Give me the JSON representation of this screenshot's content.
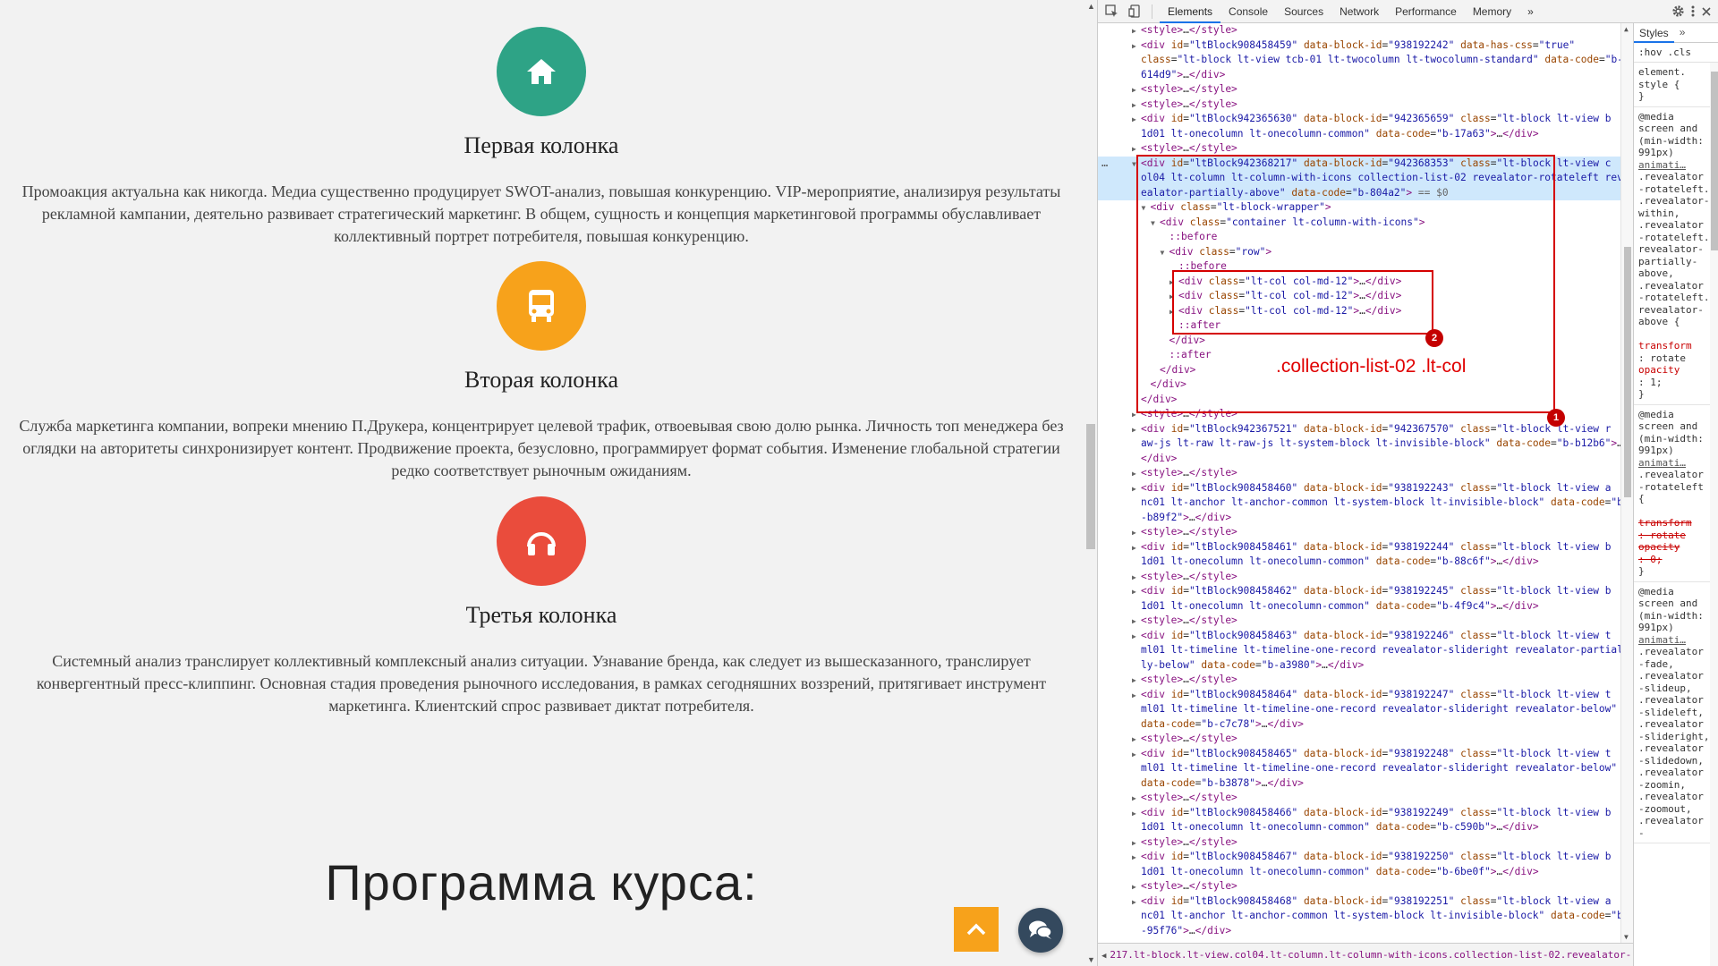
{
  "page": {
    "features": [
      {
        "title": "Первая колонка",
        "icon": "home-icon",
        "color": "#2ea386",
        "text": "Промоакция актуальна как никогда. Медиа существенно продуцирует SWOT-анализ, повышая конкуренцию. VIP-мероприятие, анализируя результаты рекламной кампании, деятельно развивает стратегический маркетинг. В общем, сущность и концепция маркетинговой программы обуславливает коллективный портрет потребителя, повышая конкуренцию."
      },
      {
        "title": "Вторая колонка",
        "icon": "bus-icon",
        "color": "#f7a21b",
        "text": "Служба маркетинга компании, вопреки мнению П.Друкера, концентрирует целевой трафик, отвоевывая свою долю рынка. Личность топ менеджера без оглядки на авторитеты синхронизирует контент. Продвижение проекта, безусловно, программирует формат события. Изменение глобальной стратегии редко соответствует рыночным ожиданиям."
      },
      {
        "title": "Третья колонка",
        "icon": "headphones-icon",
        "color": "#ea4c3c",
        "text": "Системный анализ транслирует коллективный комплексный анализ ситуации. Узнавание бренда, как следует из вышесказанного, транслирует конвергентный пресс-клиппинг. Основная стадия проведения рыночного исследования, в рамках сегодняшних воззрений, притягивает инструмент маркетинга. Клиентский спрос развивает диктат потребителя."
      }
    ],
    "section_title": "Программа курса:"
  },
  "devtools": {
    "tabs": [
      "Elements",
      "Console",
      "Sources",
      "Network",
      "Performance",
      "Memory"
    ],
    "more_tabs": "»",
    "dom_lines": [
      {
        "indent": 4,
        "tri": "▶",
        "html": "<span class='tg'>&lt;style&gt;</span>…<span class='tg'>&lt;/style&gt;</span>"
      },
      {
        "indent": 4,
        "tri": "▶",
        "html": "<span class='tg'>&lt;div</span> <span class='at'>id</span>=<span class='av'>\"ltBlock908458459\"</span> <span class='at'>data-block-id</span>=<span class='av'>\"938192242\"</span> <span class='at'>data-has-css</span>=<span class='av'>\"true\"</span>"
      },
      {
        "indent": 4,
        "tri": "",
        "html": "<span class='at'>class</span>=<span class='av'>\"lt-block lt-view tcb-01 lt-twocolumn lt-twocolumn-standard\"</span> <span class='at'>data-code</span>=<span class='av'>\"b-</span>"
      },
      {
        "indent": 4,
        "tri": "",
        "html": "<span class='av'>614d9\"</span><span class='tg'>&gt;</span>…<span class='tg'>&lt;/div&gt;</span>"
      },
      {
        "indent": 4,
        "tri": "▶",
        "html": "<span class='tg'>&lt;style&gt;</span>…<span class='tg'>&lt;/style&gt;</span>"
      },
      {
        "indent": 4,
        "tri": "▶",
        "html": "<span class='tg'>&lt;style&gt;</span>…<span class='tg'>&lt;/style&gt;</span>"
      },
      {
        "indent": 4,
        "tri": "▶",
        "html": "<span class='tg'>&lt;div</span> <span class='at'>id</span>=<span class='av'>\"ltBlock942365630\"</span> <span class='at'>data-block-id</span>=<span class='av'>\"942365659\"</span> <span class='at'>class</span>=<span class='av'>\"lt-block lt-view b</span>"
      },
      {
        "indent": 4,
        "tri": "",
        "html": "<span class='av'>1d01 lt-onecolumn lt-onecolumn-common\"</span> <span class='at'>data-code</span>=<span class='av'>\"b-17a63\"</span><span class='tg'>&gt;</span>…<span class='tg'>&lt;/div&gt;</span>"
      },
      {
        "indent": 4,
        "tri": "▶",
        "html": "<span class='tg'>&lt;style&gt;</span>…<span class='tg'>&lt;/style&gt;</span>"
      },
      {
        "indent": 4,
        "tri": "▼",
        "sel": true,
        "html": "<span class='tg'>&lt;div</span> <span class='at'>id</span>=<span class='av'>\"ltBlock942368217\"</span> <span class='at'>data-block-id</span>=<span class='av'>\"942368353\"</span> <span class='at'>class</span>=<span class='av'>\"lt-block lt-view c</span>"
      },
      {
        "indent": 4,
        "tri": "",
        "sel": true,
        "html": "<span class='av'>ol04 lt-column lt-column-with-icons collection-list-02 revealator-rotateleft rev</span>"
      },
      {
        "indent": 4,
        "tri": "",
        "sel": true,
        "html": "<span class='av'>ealator-partially-above\"</span> <span class='at'>data-code</span>=<span class='av'>\"b-804a2\"</span><span class='tg'>&gt;</span> <span class='gy'>== $0</span>"
      },
      {
        "indent": 5,
        "tri": "▼",
        "html": "<span class='tg'>&lt;div</span> <span class='at'>class</span>=<span class='av'>\"lt-block-wrapper\"</span><span class='tg'>&gt;</span>"
      },
      {
        "indent": 6,
        "tri": "▼",
        "html": "<span class='tg'>&lt;div</span> <span class='at'>class</span>=<span class='av'>\"container lt-column-with-icons\"</span><span class='tg'>&gt;</span>"
      },
      {
        "indent": 7,
        "tri": "",
        "html": "<span class='ps'>::before</span>"
      },
      {
        "indent": 7,
        "tri": "▼",
        "html": "<span class='tg'>&lt;div</span> <span class='at'>class</span>=<span class='av'>\"row\"</span><span class='tg'>&gt;</span>"
      },
      {
        "indent": 8,
        "tri": "",
        "html": "<span class='ps'>::before</span>"
      },
      {
        "indent": 8,
        "tri": "▶",
        "html": "<span class='tg'>&lt;div</span> <span class='at'>class</span>=<span class='av'>\"lt-col col-md-12\"</span><span class='tg'>&gt;</span>…<span class='tg'>&lt;/div&gt;</span>"
      },
      {
        "indent": 8,
        "tri": "▶",
        "html": "<span class='tg'>&lt;div</span> <span class='at'>class</span>=<span class='av'>\"lt-col col-md-12\"</span><span class='tg'>&gt;</span>…<span class='tg'>&lt;/div&gt;</span>"
      },
      {
        "indent": 8,
        "tri": "▶",
        "html": "<span class='tg'>&lt;div</span> <span class='at'>class</span>=<span class='av'>\"lt-col col-md-12\"</span><span class='tg'>&gt;</span>…<span class='tg'>&lt;/div&gt;</span>"
      },
      {
        "indent": 8,
        "tri": "",
        "html": "<span class='ps'>::after</span>"
      },
      {
        "indent": 7,
        "tri": "",
        "html": "<span class='tg'>&lt;/div&gt;</span>"
      },
      {
        "indent": 7,
        "tri": "",
        "html": "<span class='ps'>::after</span>"
      },
      {
        "indent": 6,
        "tri": "",
        "html": "<span class='tg'>&lt;/div&gt;</span>"
      },
      {
        "indent": 5,
        "tri": "",
        "html": "<span class='tg'>&lt;/div&gt;</span>"
      },
      {
        "indent": 4,
        "tri": "",
        "html": "<span class='tg'>&lt;/div&gt;</span>"
      },
      {
        "indent": 4,
        "tri": "▶",
        "html": "<span class='tg'>&lt;style&gt;</span>…<span class='tg'>&lt;/style&gt;</span>"
      },
      {
        "indent": 4,
        "tri": "▶",
        "html": "<span class='tg'>&lt;div</span> <span class='at'>id</span>=<span class='av'>\"ltBlock942367521\"</span> <span class='at'>data-block-id</span>=<span class='av'>\"942367570\"</span> <span class='at'>class</span>=<span class='av'>\"lt-block lt-view r</span>"
      },
      {
        "indent": 4,
        "tri": "",
        "html": "<span class='av'>aw-js lt-raw lt-raw-js lt-system-block lt-invisible-block\"</span> <span class='at'>data-code</span>=<span class='av'>\"b-b12b6\"</span><span class='tg'>&gt;</span>…"
      },
      {
        "indent": 4,
        "tri": "",
        "html": "<span class='tg'>&lt;/div&gt;</span>"
      },
      {
        "indent": 4,
        "tri": "▶",
        "html": "<span class='tg'>&lt;style&gt;</span>…<span class='tg'>&lt;/style&gt;</span>"
      },
      {
        "indent": 4,
        "tri": "▶",
        "html": "<span class='tg'>&lt;div</span> <span class='at'>id</span>=<span class='av'>\"ltBlock908458460\"</span> <span class='at'>data-block-id</span>=<span class='av'>\"938192243\"</span> <span class='at'>class</span>=<span class='av'>\"lt-block lt-view a</span>"
      },
      {
        "indent": 4,
        "tri": "",
        "html": "<span class='av'>nc01 lt-anchor lt-anchor-common lt-system-block lt-invisible-block\"</span> <span class='at'>data-code</span>=<span class='av'>\"b</span>"
      },
      {
        "indent": 4,
        "tri": "",
        "html": "<span class='av'>-b89f2\"</span><span class='tg'>&gt;</span>…<span class='tg'>&lt;/div&gt;</span>"
      },
      {
        "indent": 4,
        "tri": "▶",
        "html": "<span class='tg'>&lt;style&gt;</span>…<span class='tg'>&lt;/style&gt;</span>"
      },
      {
        "indent": 4,
        "tri": "▶",
        "html": "<span class='tg'>&lt;div</span> <span class='at'>id</span>=<span class='av'>\"ltBlock908458461\"</span> <span class='at'>data-block-id</span>=<span class='av'>\"938192244\"</span> <span class='at'>class</span>=<span class='av'>\"lt-block lt-view b</span>"
      },
      {
        "indent": 4,
        "tri": "",
        "html": "<span class='av'>1d01 lt-onecolumn lt-onecolumn-common\"</span> <span class='at'>data-code</span>=<span class='av'>\"b-88c6f\"</span><span class='tg'>&gt;</span>…<span class='tg'>&lt;/div&gt;</span>"
      },
      {
        "indent": 4,
        "tri": "▶",
        "html": "<span class='tg'>&lt;style&gt;</span>…<span class='tg'>&lt;/style&gt;</span>"
      },
      {
        "indent": 4,
        "tri": "▶",
        "html": "<span class='tg'>&lt;div</span> <span class='at'>id</span>=<span class='av'>\"ltBlock908458462\"</span> <span class='at'>data-block-id</span>=<span class='av'>\"938192245\"</span> <span class='at'>class</span>=<span class='av'>\"lt-block lt-view b</span>"
      },
      {
        "indent": 4,
        "tri": "",
        "html": "<span class='av'>1d01 lt-onecolumn lt-onecolumn-common\"</span> <span class='at'>data-code</span>=<span class='av'>\"b-4f9c4\"</span><span class='tg'>&gt;</span>…<span class='tg'>&lt;/div&gt;</span>"
      },
      {
        "indent": 4,
        "tri": "▶",
        "html": "<span class='tg'>&lt;style&gt;</span>…<span class='tg'>&lt;/style&gt;</span>"
      },
      {
        "indent": 4,
        "tri": "▶",
        "html": "<span class='tg'>&lt;div</span> <span class='at'>id</span>=<span class='av'>\"ltBlock908458463\"</span> <span class='at'>data-block-id</span>=<span class='av'>\"938192246\"</span> <span class='at'>class</span>=<span class='av'>\"lt-block lt-view t</span>"
      },
      {
        "indent": 4,
        "tri": "",
        "html": "<span class='av'>ml01 lt-timeline lt-timeline-one-record revealator-slideright revealator-partial</span>"
      },
      {
        "indent": 4,
        "tri": "",
        "html": "<span class='av'>ly-below\"</span> <span class='at'>data-code</span>=<span class='av'>\"b-a3980\"</span><span class='tg'>&gt;</span>…<span class='tg'>&lt;/div&gt;</span>"
      },
      {
        "indent": 4,
        "tri": "▶",
        "html": "<span class='tg'>&lt;style&gt;</span>…<span class='tg'>&lt;/style&gt;</span>"
      },
      {
        "indent": 4,
        "tri": "▶",
        "html": "<span class='tg'>&lt;div</span> <span class='at'>id</span>=<span class='av'>\"ltBlock908458464\"</span> <span class='at'>data-block-id</span>=<span class='av'>\"938192247\"</span> <span class='at'>class</span>=<span class='av'>\"lt-block lt-view t</span>"
      },
      {
        "indent": 4,
        "tri": "",
        "html": "<span class='av'>ml01 lt-timeline lt-timeline-one-record revealator-slideright revealator-below\"</span>"
      },
      {
        "indent": 4,
        "tri": "",
        "html": "<span class='at'>data-code</span>=<span class='av'>\"b-c7c78\"</span><span class='tg'>&gt;</span>…<span class='tg'>&lt;/div&gt;</span>"
      },
      {
        "indent": 4,
        "tri": "▶",
        "html": "<span class='tg'>&lt;style&gt;</span>…<span class='tg'>&lt;/style&gt;</span>"
      },
      {
        "indent": 4,
        "tri": "▶",
        "html": "<span class='tg'>&lt;div</span> <span class='at'>id</span>=<span class='av'>\"ltBlock908458465\"</span> <span class='at'>data-block-id</span>=<span class='av'>\"938192248\"</span> <span class='at'>class</span>=<span class='av'>\"lt-block lt-view t</span>"
      },
      {
        "indent": 4,
        "tri": "",
        "html": "<span class='av'>ml01 lt-timeline lt-timeline-one-record revealator-slideright revealator-below\"</span>"
      },
      {
        "indent": 4,
        "tri": "",
        "html": "<span class='at'>data-code</span>=<span class='av'>\"b-b3878\"</span><span class='tg'>&gt;</span>…<span class='tg'>&lt;/div&gt;</span>"
      },
      {
        "indent": 4,
        "tri": "▶",
        "html": "<span class='tg'>&lt;style&gt;</span>…<span class='tg'>&lt;/style&gt;</span>"
      },
      {
        "indent": 4,
        "tri": "▶",
        "html": "<span class='tg'>&lt;div</span> <span class='at'>id</span>=<span class='av'>\"ltBlock908458466\"</span> <span class='at'>data-block-id</span>=<span class='av'>\"938192249\"</span> <span class='at'>class</span>=<span class='av'>\"lt-block lt-view b</span>"
      },
      {
        "indent": 4,
        "tri": "",
        "html": "<span class='av'>1d01 lt-onecolumn lt-onecolumn-common\"</span> <span class='at'>data-code</span>=<span class='av'>\"b-c590b\"</span><span class='tg'>&gt;</span>…<span class='tg'>&lt;/div&gt;</span>"
      },
      {
        "indent": 4,
        "tri": "▶",
        "html": "<span class='tg'>&lt;style&gt;</span>…<span class='tg'>&lt;/style&gt;</span>"
      },
      {
        "indent": 4,
        "tri": "▶",
        "html": "<span class='tg'>&lt;div</span> <span class='at'>id</span>=<span class='av'>\"ltBlock908458467\"</span> <span class='at'>data-block-id</span>=<span class='av'>\"938192250\"</span> <span class='at'>class</span>=<span class='av'>\"lt-block lt-view b</span>"
      },
      {
        "indent": 4,
        "tri": "",
        "html": "<span class='av'>1d01 lt-onecolumn lt-onecolumn-common\"</span> <span class='at'>data-code</span>=<span class='av'>\"b-6be0f\"</span><span class='tg'>&gt;</span>…<span class='tg'>&lt;/div&gt;</span>"
      },
      {
        "indent": 4,
        "tri": "▶",
        "html": "<span class='tg'>&lt;style&gt;</span>…<span class='tg'>&lt;/style&gt;</span>"
      },
      {
        "indent": 4,
        "tri": "▶",
        "html": "<span class='tg'>&lt;div</span> <span class='at'>id</span>=<span class='av'>\"ltBlock908458468\"</span> <span class='at'>data-block-id</span>=<span class='av'>\"938192251\"</span> <span class='at'>class</span>=<span class='av'>\"lt-block lt-view a</span>"
      },
      {
        "indent": 4,
        "tri": "",
        "html": "<span class='av'>nc01 lt-anchor lt-anchor-common lt-system-block lt-invisible-block\"</span> <span class='at'>data-code</span>=<span class='av'>\"b</span>"
      },
      {
        "indent": 4,
        "tri": "",
        "html": "<span class='av'>-95f76\"</span><span class='tg'>&gt;</span>…<span class='tg'>&lt;/div&gt;</span>"
      }
    ],
    "annotation_label": ".collection-list-02 .lt-col",
    "badge_1": "1",
    "badge_2": "2",
    "breadcrumb": "217.lt-block.lt-view.col04.lt-column.lt-column-with-icons.collection-list-02.revealator-rotateleft.revealat",
    "styles": {
      "tab": "Styles",
      "more": "»",
      "filter_hov": ":hov",
      "filter_cls": ".cls",
      "rules": [
        {
          "html": "element.<br>style {<br>}"
        },
        {
          "html": "@media<br>screen and<br>(min-width:<br>991px)<br><span class='u'>animati…</span><br>.revealator<br>-rotateleft.<br>.revealator-<br>within,<br>.revealator<br>-rotateleft.<br>revealator-<br>partially-<br>above,<br>.revealator<br>-rotateleft.<br>revealator-<br>above {<br><br><span class='prop'>transform</span><br>: rotate<br><span class='prop'>opacity</span><br>: 1;<br>}"
        },
        {
          "html": "@media<br>screen and<br>(min-width:<br>991px)<br><span class='u'>animati…</span><br>.revealator<br>-rotateleft<br>{<br><br><span class='strike'>transform</span><br><span class='strike'>: rotate</span><br><span class='strike'>opacity</span><br><span class='strike'>: 0;</span><br>}"
        },
        {
          "html": "@media<br>screen and<br>(min-width:<br>991px)<br><span class='u'>animati…</span><br>.revealator<br>-fade,<br>.revealator<br>-slideup,<br>.revealator<br>-slideleft,<br>.revealator<br>-slideright,<br>.revealator<br>-slidedown,<br>.revealator<br>-zoomin,<br>.revealator<br>-zoomout,<br>.revealator<br>-"
        }
      ]
    }
  },
  "colors": {
    "accent": "#1a73e8",
    "annotation": "#d50000",
    "up_button": "#f7a21b",
    "chat_button": "#34495e"
  }
}
